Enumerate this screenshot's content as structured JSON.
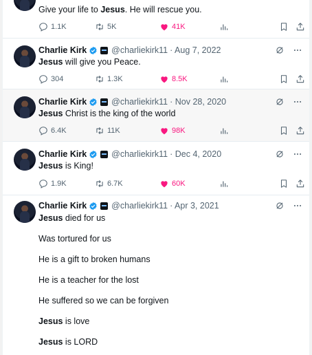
{
  "colors": {
    "like": "#f91880",
    "muted": "#536471",
    "verified": "#1d9bf0"
  },
  "tweets": [
    {
      "text_pre": "Give your life to ",
      "text_bold": "Jesus",
      "text_post": ". He will rescue you.",
      "stats": {
        "replies": "1.1K",
        "retweets": "5K",
        "likes": "41K"
      }
    },
    {
      "name": "Charlie Kirk",
      "handle": "@charliekirk11",
      "date": "· Aug 7, 2022",
      "text_bold": "Jesus",
      "text_post": " will give you Peace.",
      "stats": {
        "replies": "304",
        "retweets": "1.3K",
        "likes": "8.5K"
      }
    },
    {
      "name": "Charlie Kirk",
      "handle": "@charliekirk11",
      "date": "· Nov 28, 2020",
      "text_bold": "Jesus",
      "text_post": " Christ is the king of the world",
      "stats": {
        "replies": "6.4K",
        "retweets": "11K",
        "likes": "98K"
      }
    },
    {
      "name": "Charlie Kirk",
      "handle": "@charliekirk11",
      "date": "· Dec 4, 2020",
      "text_bold": "Jesus",
      "text_post": " is King!",
      "stats": {
        "replies": "1.9K",
        "retweets": "6.7K",
        "likes": "60K"
      }
    },
    {
      "name": "Charlie Kirk",
      "handle": "@charliekirk11",
      "date": "· Apr 3, 2021",
      "lines": [
        {
          "bold": "Jesus",
          "rest": " died for us"
        },
        {
          "bold": "",
          "rest": "Was tortured for us"
        },
        {
          "bold": "",
          "rest": "He is a gift to broken humans"
        },
        {
          "bold": "",
          "rest": "He is a teacher for the lost"
        },
        {
          "bold": "",
          "rest": "He suffered so we can be forgiven"
        },
        {
          "bold": "Jesus",
          "rest": " is love"
        },
        {
          "bold": "Jesus",
          "rest": " is LORD"
        }
      ]
    }
  ]
}
